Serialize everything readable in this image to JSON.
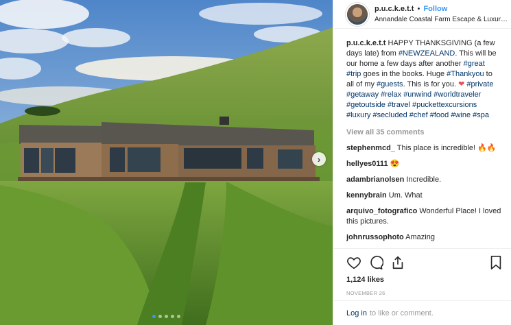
{
  "post": {
    "username": "p.u.c.k.e.t.t",
    "separator": "•",
    "follow_label": "Follow",
    "location": "Annandale Coastal Farm Escape & Luxury ...",
    "caption": {
      "author": "p.u.c.k.e.t.t",
      "text_1": "HAPPY THANKSGIVING (a few days late) from",
      "tag_nz": "#NEWZEALAND",
      "text_2": ". This will be our home a few days after another",
      "tag_great": "#great",
      "tag_trip": "#trip",
      "text_3": "goes in the books. Huge",
      "tag_thankyou": "#Thankyou",
      "text_4": "to all of my",
      "tag_guests": "#guests",
      "text_5": ". This is for you.",
      "heart": "❤",
      "tags_tail": [
        "#private",
        "#getaway",
        "#relax",
        "#unwind",
        "#worldtraveler",
        "#getoutside",
        "#travel",
        "#puckettexcursions",
        "#luxury",
        "#secluded",
        "#chef",
        "#food",
        "#wine",
        "#spa"
      ]
    },
    "view_all": "View all 35 comments",
    "comments": [
      {
        "user": "stephenmcd_",
        "text": "This place is incredible! 🔥🔥"
      },
      {
        "user": "hellyes0111",
        "text": "😍"
      },
      {
        "user": "adambrianolsen",
        "text": "Incredible."
      },
      {
        "user": "kennybrain",
        "text": "Um. What"
      },
      {
        "user": "arquivo_fotografico",
        "text": "Wonderful Place! I loved this pictures."
      },
      {
        "user": "johnrussophoto",
        "text": "Amazing"
      }
    ],
    "likes": "1,124 likes",
    "date": "NOVEMBER 26",
    "login_link": "Log in",
    "login_text": "to like or comment."
  },
  "icons": [
    "heart-outline-icon",
    "comment-icon",
    "share-icon",
    "bookmark-icon",
    "chevron-right-icon"
  ],
  "colors": {
    "link": "#003569",
    "follow": "#3897f0",
    "heart": "#ed4956",
    "muted": "#999999"
  }
}
